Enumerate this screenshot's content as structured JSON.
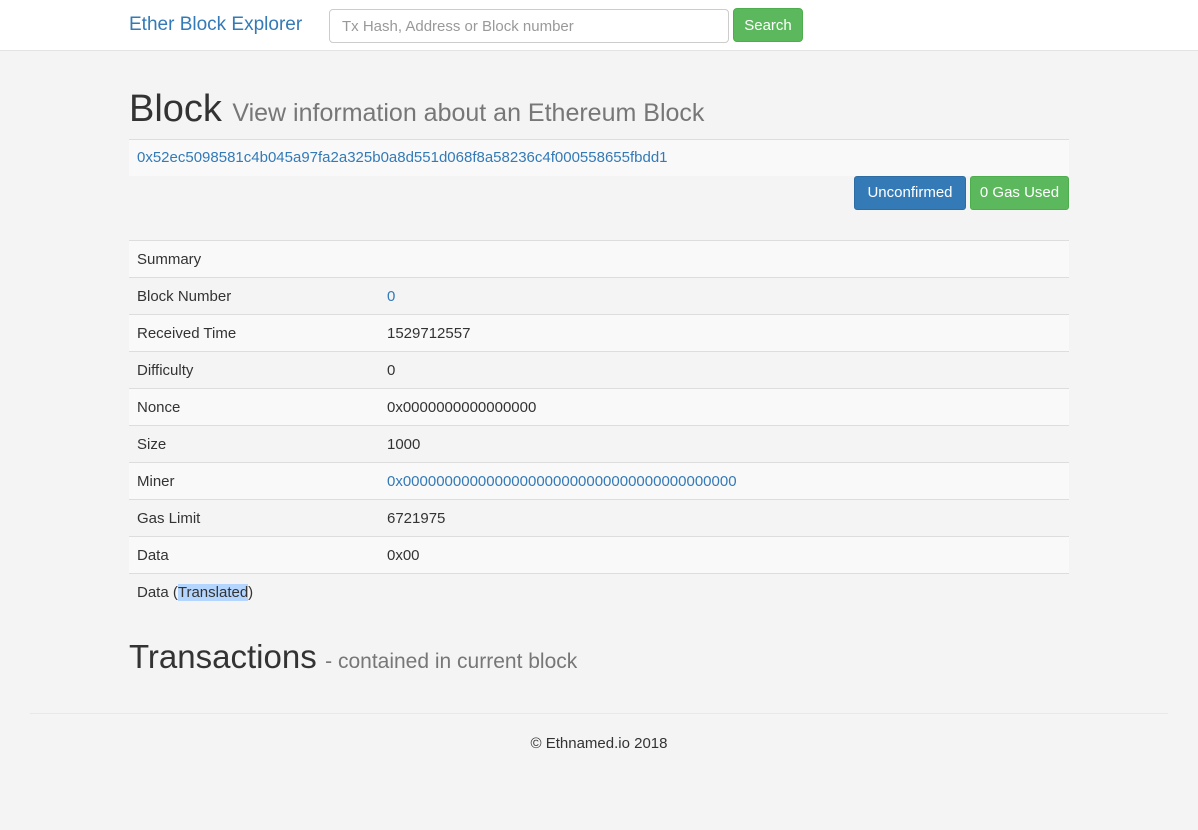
{
  "navbar": {
    "brand": "Ether Block Explorer",
    "search_placeholder": "Tx Hash, Address or Block number",
    "search_value": "",
    "search_button": "Search"
  },
  "header": {
    "title": "Block",
    "subtitle": "View information about an Ethereum Block"
  },
  "block": {
    "hash": "0x52ec5098581c4b045a97fa2a325b0a8d551d068f8a58236c4f000558655fbdd1",
    "status_label": "Unconfirmed",
    "gas_used_label": "0 Gas Used"
  },
  "table": {
    "summary": "Summary",
    "rows": [
      {
        "label": "Block Number",
        "value": "0"
      },
      {
        "label": "Received Time",
        "value": "1529712557"
      },
      {
        "label": "Difficulty",
        "value": "0"
      },
      {
        "label": "Nonce",
        "value": "0x0000000000000000"
      },
      {
        "label": "Size",
        "value": "1000"
      },
      {
        "label": "Miner",
        "value": "0x0000000000000000000000000000000000000000"
      },
      {
        "label": "Gas Limit",
        "value": "6721975"
      },
      {
        "label": "Data",
        "value": "0x00"
      }
    ],
    "translated": {
      "prefix": "Data (",
      "selected": "Translated",
      "suffix": ")"
    }
  },
  "transactions": {
    "title": "Transactions",
    "subtitle": "- contained in current block"
  },
  "footer": {
    "copyright": "© Ethnamed.io 2018"
  },
  "colors": {
    "link": "#337ab7",
    "success": "#5cb85c",
    "primary": "#337ab7",
    "background": "#f4f4f4"
  }
}
